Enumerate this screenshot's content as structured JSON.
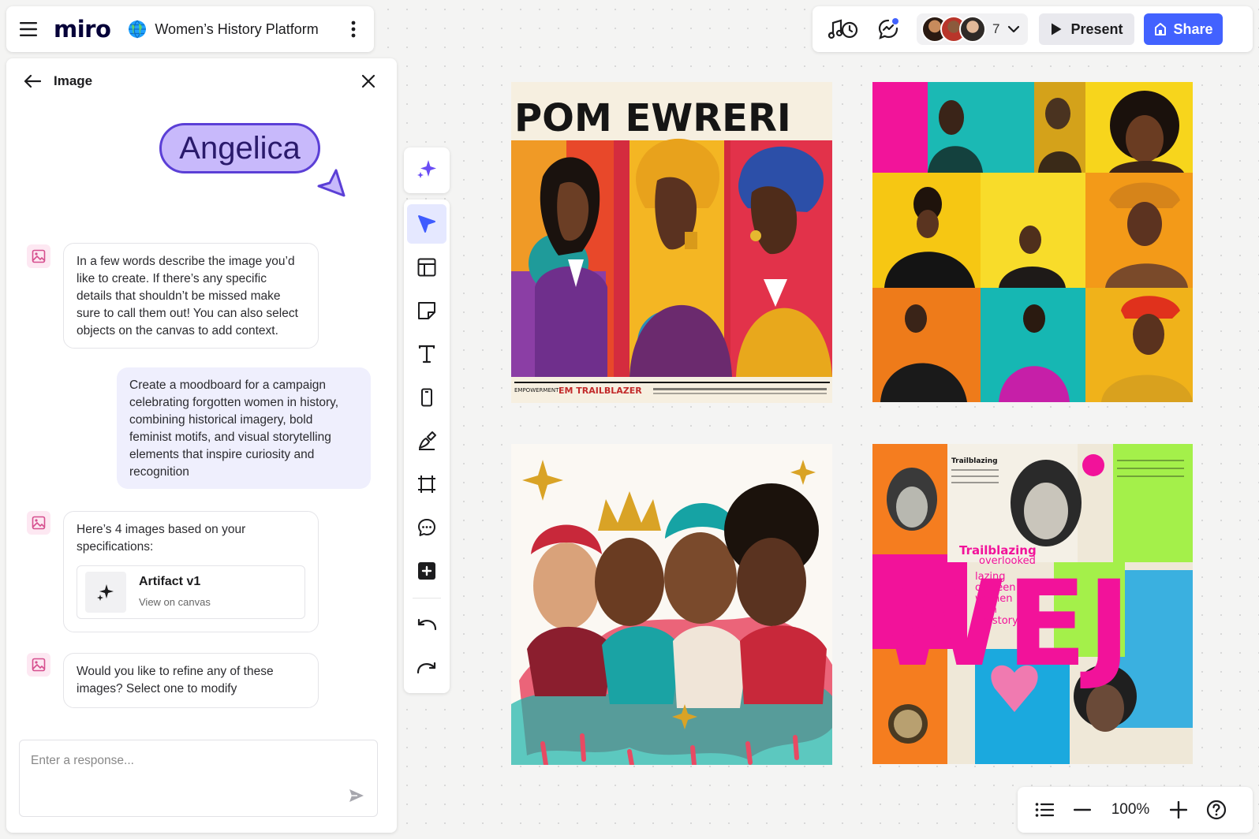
{
  "header": {
    "logo": "miro",
    "board_name": "Women’s History Platform"
  },
  "collab": {
    "avatar_count": "7",
    "present_label": "Present",
    "share_label": "Share",
    "accent": "#4262ff"
  },
  "panel": {
    "title": "Image",
    "cursor_name": "Angelica",
    "messages": [
      {
        "role": "assistant",
        "text": "In a few words describe the image you’d like to create. If there’s any specific details that shouldn’t be missed make sure to call them  out! You can also select objects on the canvas to add context."
      },
      {
        "role": "user",
        "text": "Create a moodboard for a campaign celebrating forgotten women in history, combining historical imagery, bold feminist motifs, and visual storytelling elements that inspire curiosity and recognition"
      },
      {
        "role": "assistant",
        "text": "Here’s 4 images based on your specifications:"
      },
      {
        "role": "assistant",
        "text": "Would you like to refine any of these images? Select one to modify"
      }
    ],
    "artifact": {
      "title": "Artifact v1",
      "subtitle": "View on canvas"
    },
    "reply_placeholder": "Enter a response..."
  },
  "canvas": {
    "image1": {
      "headline": "POM EWRERI",
      "caption": "EM TRAILBLAZER",
      "small_caption": "EMPOWERMENT"
    },
    "image4": {
      "big_letters": "WEJ",
      "label_trailblazing": "Trailblazing",
      "label_overlooked": "overlooked",
      "small_heading": "Trailblazing",
      "stacked_lines": [
        "lazing",
        "ovloeen",
        "women",
        "in in",
        "history"
      ]
    }
  },
  "zoom": {
    "level": "100%"
  }
}
